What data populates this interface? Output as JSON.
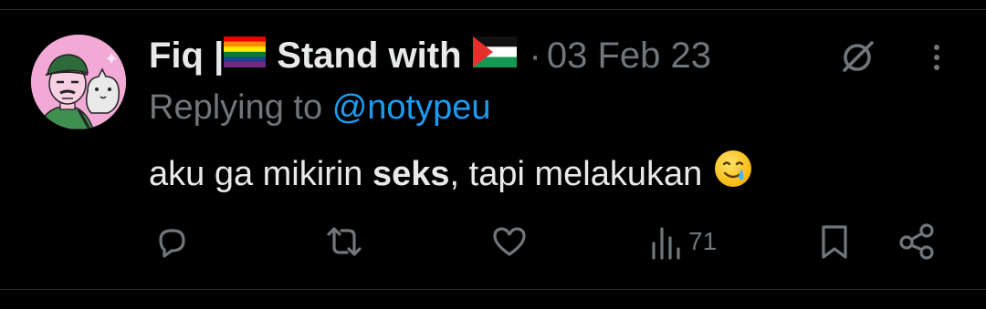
{
  "tweet": {
    "author": {
      "name_prefix": "Fiq |",
      "name_suffix": "Stand with",
      "avatar": "avatar-illustration"
    },
    "timestamp_separator": "·",
    "timestamp": "03 Feb 23",
    "replying_to_label": "Replying to",
    "replying_to_handle": "@notypeu",
    "text": {
      "before": "aku ga mikirin ",
      "bold": "seks",
      "after": ", tapi melakukan"
    },
    "emoji": "smiling-face-with-tear-emoji"
  },
  "actions": {
    "reply_icon": "reply-icon",
    "retweet_icon": "retweet-icon",
    "like_icon": "heart-icon",
    "views_icon": "views-icon",
    "views_count": "71",
    "bookmark_icon": "bookmark-icon",
    "share_icon": "share-icon"
  },
  "header_icons": {
    "grok": "grok-icon",
    "more": "more-vertical-icon"
  },
  "colors": {
    "background": "#000000",
    "primary_text": "#e7e9ea",
    "secondary_text": "#71767b",
    "link": "#1d9bf0",
    "avatar_bg": "#f2a9d6",
    "divider": "#2f3336"
  }
}
